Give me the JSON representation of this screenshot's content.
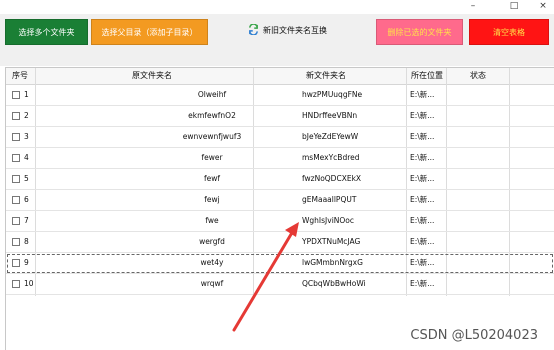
{
  "window": {
    "minimize": "–",
    "maximize": "□",
    "close": "×"
  },
  "toolbar": {
    "select_files": "选择多个文件夹",
    "select_parent": "选择父目录（添加子目录）",
    "swap_names": "新旧文件夹名互换",
    "delete_selected": "删除已选的文件夹",
    "clear_table": "清空表格",
    "colors": {
      "green": "#1a7f35",
      "orange": "#f39a21",
      "pink": "#ff6a8c",
      "red": "#ff1414",
      "yellow_text": "#ffe24a"
    }
  },
  "table": {
    "headers": {
      "index": "序号",
      "original": "原文件夹名",
      "new": "新文件夹名",
      "location": "所在位置",
      "status": "状态"
    },
    "rows": [
      {
        "idx": "1",
        "original": "Olweihf",
        "new": "hwzPMUuqgFNe",
        "location": "E:\\新...",
        "status": ""
      },
      {
        "idx": "2",
        "original": "ekmfewfnO2",
        "new": "HNDrffeeVBNn",
        "location": "E:\\新...",
        "status": ""
      },
      {
        "idx": "3",
        "original": "ewnvewnfjwuf3",
        "new": "bJeYeZdEYewW",
        "location": "E:\\新...",
        "status": ""
      },
      {
        "idx": "4",
        "original": "fewer",
        "new": "msMexYcBdred",
        "location": "E:\\新...",
        "status": ""
      },
      {
        "idx": "5",
        "original": "fewf",
        "new": "fwzNoQDCXEkX",
        "location": "E:\\新...",
        "status": ""
      },
      {
        "idx": "6",
        "original": "fewj",
        "new": "gEMaaallPQUT",
        "location": "E:\\新...",
        "status": ""
      },
      {
        "idx": "7",
        "original": "fwe",
        "new": "WghIsJviNOoc",
        "location": "E:\\新...",
        "status": ""
      },
      {
        "idx": "8",
        "original": "wergfd",
        "new": "YPDXTNuMcJAG",
        "location": "E:\\新...",
        "status": ""
      },
      {
        "idx": "9",
        "original": "wet4y",
        "new": "lwGMmbnNrgxG",
        "location": "E:\\新...",
        "status": ""
      },
      {
        "idx": "10",
        "original": "wrqwf",
        "new": "QCbqWbBwHoWi",
        "location": "E:\\新...",
        "status": ""
      }
    ]
  },
  "annotation": {
    "arrow_color": "#e53935"
  },
  "watermark": "CSDN @L50204023"
}
